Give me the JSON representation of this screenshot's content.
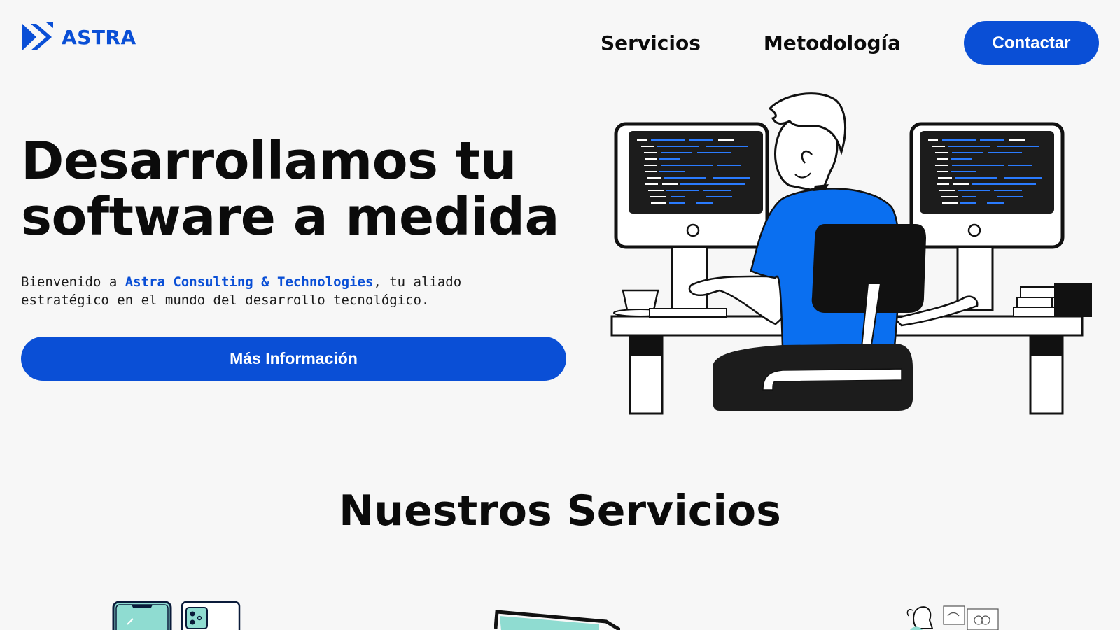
{
  "header": {
    "logo_text": "ASTRA",
    "nav": [
      {
        "label": "Servicios"
      },
      {
        "label": "Metodología"
      }
    ],
    "contact_label": "Contactar"
  },
  "hero": {
    "title_line1": "Desarrollamos tu",
    "title_line2": "software a medida",
    "subtitle_prefix": "Bienvenido a ",
    "subtitle_brand": "Astra Consulting & Technologies",
    "subtitle_suffix_line1": ", tu aliado",
    "subtitle_line2": "estratégico en el mundo del desarrollo tecnológico.",
    "cta_label": "Más Información"
  },
  "services": {
    "title": "Nuestros Servicios",
    "icons": [
      "mobile-app-icon",
      "laptop-icon",
      "design-icon"
    ]
  },
  "colors": {
    "brand": "#0a4fd6",
    "text": "#0b0b0b",
    "background": "#f7f7f7",
    "accent_teal": "#8fdcd1"
  }
}
